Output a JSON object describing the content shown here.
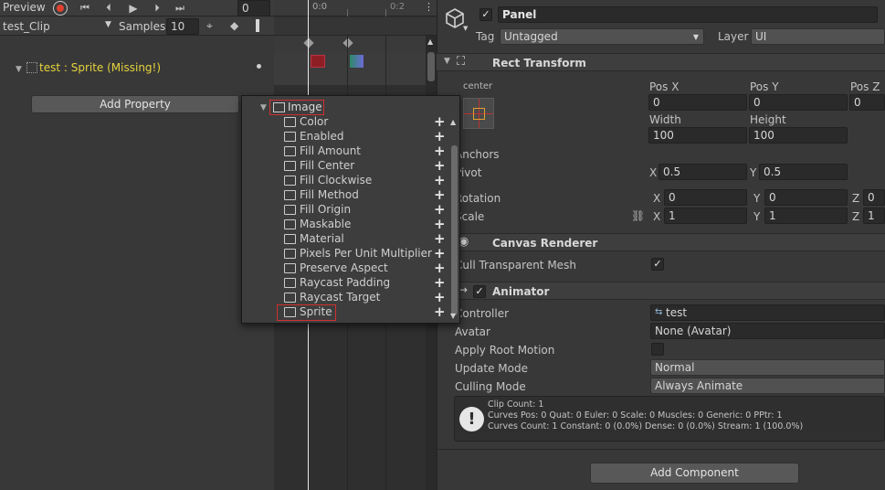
{
  "animation": {
    "preview_label": "Preview",
    "frame_value": "0",
    "clip_name": "test_Clip",
    "samples_label": "Samples",
    "samples_value": "10",
    "timeline_ticks": [
      "0:0",
      "0:2"
    ],
    "property_row": "test : Sprite (Missing!)",
    "add_property_label": "Add Property"
  },
  "popup": {
    "group": "Image",
    "items": [
      "Color",
      "Enabled",
      "Fill Amount",
      "Fill Center",
      "Fill Clockwise",
      "Fill Method",
      "Fill Origin",
      "Maskable",
      "Material",
      "Pixels Per Unit Multiplier",
      "Preserve Aspect",
      "Raycast Padding",
      "Raycast Target",
      "Sprite"
    ],
    "selected": "Sprite"
  },
  "inspector": {
    "object_name": "Panel",
    "tag_label": "Tag",
    "tag_value": "Untagged",
    "layer_label": "Layer",
    "layer_value": "UI",
    "rect_transform": {
      "title": "Rect Transform",
      "anchor_preset": "center",
      "pos_x_label": "Pos X",
      "pos_x": "0",
      "pos_y_label": "Pos Y",
      "pos_y": "0",
      "pos_z_label": "Pos Z",
      "pos_z": "0",
      "width_label": "Width",
      "width": "100",
      "height_label": "Height",
      "height": "100",
      "anchors_label": "Anchors",
      "pivot_label": "Pivot",
      "pivot_x": "0.5",
      "pivot_y": "0.5",
      "rotation_label": "Rotation",
      "rot_x": "0",
      "rot_y": "0",
      "rot_z": "0",
      "scale_label": "Scale",
      "scale_x": "1",
      "scale_y": "1",
      "scale_z": "1",
      "axis_x": "X",
      "axis_y": "Y",
      "axis_z": "Z"
    },
    "canvas_renderer": {
      "title": "Canvas Renderer",
      "cull_label": "Cull Transparent Mesh"
    },
    "animator": {
      "title": "Animator",
      "controller_label": "Controller",
      "controller_value": "test",
      "avatar_label": "Avatar",
      "avatar_value": "None (Avatar)",
      "root_motion_label": "Apply Root Motion",
      "update_mode_label": "Update Mode",
      "update_mode_value": "Normal",
      "culling_mode_label": "Culling Mode",
      "culling_mode_value": "Always Animate",
      "info": [
        "Clip Count: 1",
        "Curves Pos: 0 Quat: 0 Euler: 0 Scale: 0 Muscles: 0 Generic: 0 PPtr: 1",
        "Curves Count: 1 Constant: 0 (0.0%) Dense: 0 (0.0%) Stream: 1 (100.0%)"
      ]
    },
    "add_component_label": "Add Component"
  },
  "colors": {
    "warning_yellow": "#e6d43c",
    "record_red": "#e0412e",
    "highlight_red": "#d23030"
  }
}
